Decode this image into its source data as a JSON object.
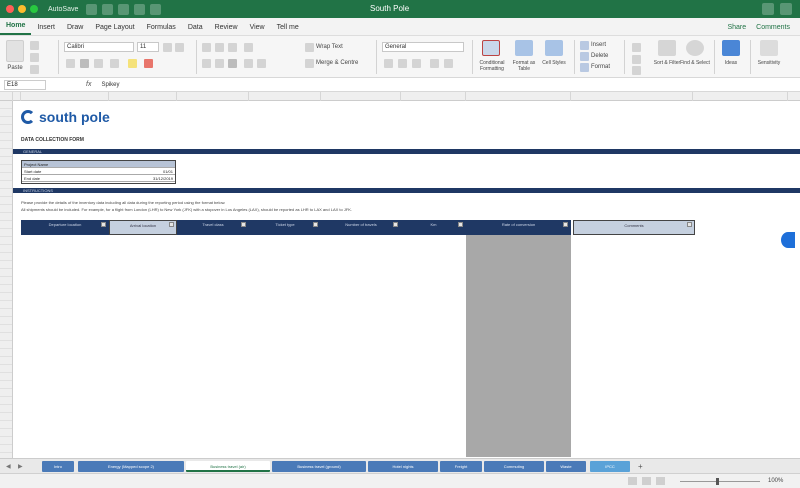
{
  "titlebar": {
    "autosave": "AutoSave",
    "document_title": "South Pole"
  },
  "ribbon_tabs": [
    "Home",
    "Insert",
    "Draw",
    "Page Layout",
    "Formulas",
    "Data",
    "Review",
    "View",
    "Tell me"
  ],
  "share": "Share",
  "comments": "Comments",
  "ribbon": {
    "paste": "Paste",
    "font_name": "Calibri",
    "font_size": "11",
    "wrap_text": "Wrap Text",
    "merge_center": "Merge & Centre",
    "number_format": "General",
    "conditional_formatting": "Conditional Formatting",
    "format_as_table": "Format as Table",
    "cell_styles": "Cell Styles",
    "insert": "Insert",
    "delete": "Delete",
    "format": "Format",
    "sort_filter": "Sort & Filter",
    "find_select": "Find & Select",
    "ideas": "Ideas",
    "sensitivity": "Sensitivity"
  },
  "formula_bar": {
    "name_box": "E18",
    "fx": "fx",
    "value": "Spikey"
  },
  "colors": {
    "excel_green": "#217346",
    "header_navy": "#1f3864",
    "logo_blue": "#1f5aa6"
  },
  "sheet": {
    "logo_text": "south pole",
    "form_title": "DATA COLLECTION FORM",
    "section1": "GENERAL",
    "section2": "INSTRUCTIONS",
    "info": [
      {
        "label": "Project Name",
        "value": ""
      },
      {
        "label": "Start date",
        "value": "01/01"
      },
      {
        "label": "End date",
        "value": "31/12/2019"
      }
    ],
    "instructions": [
      "Please provide the details of the inventory data including all data during the reporting period using the format below.",
      "All shipments should be included. For example, for a flight from London (LHR) to New York (JFK) with a stopover in Los Angeles (LAX), should be reported as LHR to LAX and LAX to JFK."
    ],
    "headers": [
      "Departure location",
      "Arrival location",
      "Travel class",
      "Ticket type",
      "Number of travels",
      "Km",
      "Rate of conversion",
      "Comments"
    ]
  },
  "sheet_tabs": [
    "Intro",
    "Energy (Mapped scope 2)",
    "Business travel (air)",
    "Business travel (ground)",
    "Hotel nights",
    "Freight",
    "Commuting",
    "Waste",
    "IPCC"
  ],
  "zoom": "100%"
}
